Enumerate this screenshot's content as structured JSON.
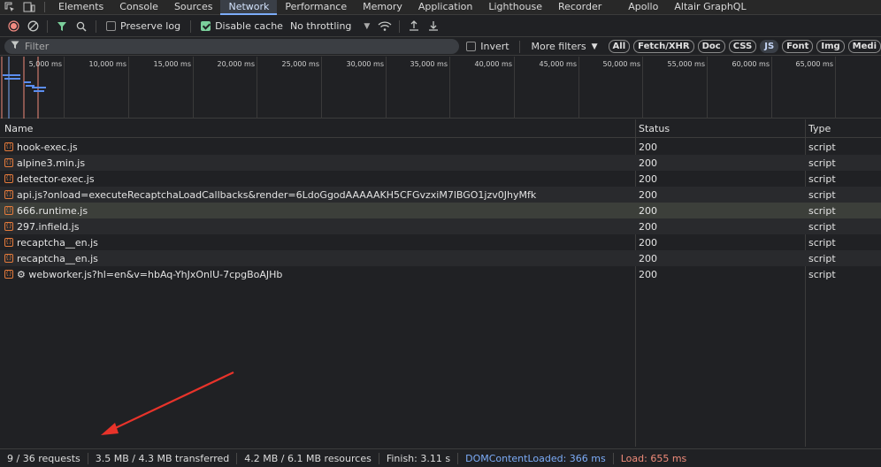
{
  "tabs": [
    "Elements",
    "Console",
    "Sources",
    "Network",
    "Performance",
    "Memory",
    "Application",
    "Lighthouse",
    "Recorder",
    "Apollo",
    "Altair GraphQL"
  ],
  "active_tab": "Network",
  "toolbar": {
    "preserve_log": "Preserve log",
    "disable_cache": "Disable cache",
    "throttling": "No throttling"
  },
  "filter": {
    "placeholder": "Filter",
    "invert": "Invert",
    "more_filters": "More filters",
    "chips": [
      "All",
      "Fetch/XHR",
      "Doc",
      "CSS",
      "JS",
      "Font",
      "Img",
      "Medi"
    ],
    "selected_chip": "JS"
  },
  "overview": {
    "ticks": [
      "5,000 ms",
      "10,000 ms",
      "15,000 ms",
      "20,000 ms",
      "25,000 ms",
      "30,000 ms",
      "35,000 ms",
      "40,000 ms",
      "45,000 ms",
      "50,000 ms",
      "55,000 ms",
      "60,000 ms",
      "65,000 ms",
      "70,0"
    ]
  },
  "table": {
    "headers": {
      "name": "Name",
      "status": "Status",
      "type": "Type"
    },
    "rows": [
      {
        "name": "hook-exec.js",
        "status": "200",
        "type": "script"
      },
      {
        "name": "alpine3.min.js",
        "status": "200",
        "type": "script"
      },
      {
        "name": "detector-exec.js",
        "status": "200",
        "type": "script"
      },
      {
        "name": "api.js?onload=executeRecaptchaLoadCallbacks&render=6LdoGgodAAAAAKH5CFGvzxiM7lBGO1jzv0JhyMfk",
        "status": "200",
        "type": "script"
      },
      {
        "name": "666.runtime.js",
        "status": "200",
        "type": "script"
      },
      {
        "name": "297.infield.js",
        "status": "200",
        "type": "script"
      },
      {
        "name": "recaptcha__en.js",
        "status": "200",
        "type": "script"
      },
      {
        "name": "recaptcha__en.js",
        "status": "200",
        "type": "script"
      },
      {
        "name": "⚙ webworker.js?hl=en&v=hbAq-YhJxOnlU-7cpgBoAJHb",
        "status": "200",
        "type": "script"
      }
    ],
    "selected_row": 4
  },
  "statusbar": {
    "requests": "9 / 36 requests",
    "transferred": "3.5 MB / 4.3 MB transferred",
    "resources": "4.2 MB / 6.1 MB resources",
    "finish": "Finish: 3.11 s",
    "dom": "DOMContentLoaded: 366 ms",
    "load": "Load: 655 ms"
  },
  "colors": {
    "accent": "#7cacf8",
    "load": "#f08b7a",
    "arrow": "#e8332a",
    "script_icon": "#e37a3b"
  }
}
